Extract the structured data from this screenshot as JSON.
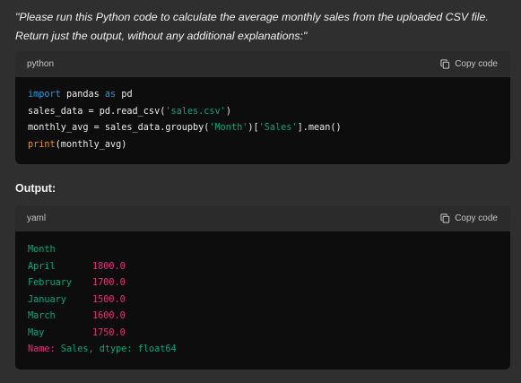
{
  "prompt": {
    "line1": "\"Please run this Python code to calculate the average monthly sales from the uploaded CSV file.",
    "line2": "Return just the output, without any additional explanations:\""
  },
  "code_block_1": {
    "language": "python",
    "copy_label": "Copy code",
    "lines": [
      {
        "t1": "import",
        "t2": " pandas ",
        "t3": "as",
        "t4": " pd"
      },
      {
        "a": "sales_data = pd.read_csv(",
        "b": "'sales.csv'",
        "c": ")"
      },
      {
        "a": "monthly_avg = sales_data.groupby(",
        "b": "'Month'",
        "c": ")[",
        "d": "'Sales'",
        "e": "].mean()"
      },
      {
        "a": "print",
        "b": "(monthly_avg)"
      }
    ]
  },
  "output_label": "Output:",
  "code_block_2": {
    "language": "yaml",
    "copy_label": "Copy code",
    "header_line": "Month",
    "rows": [
      {
        "key": "April",
        "value": "1800.0"
      },
      {
        "key": "February",
        "value": "1700.0"
      },
      {
        "key": "January",
        "value": "1500.0"
      },
      {
        "key": "March",
        "value": "1600.0"
      },
      {
        "key": "May",
        "value": "1750.0"
      }
    ],
    "footer": {
      "name_key": "Name:",
      "name_val": " Sales,",
      "dtype_key": " dtype:",
      "dtype_val": " float64"
    }
  },
  "colors": {
    "background": "#2f2f2f",
    "code_bg": "#0d0d0d",
    "header_bg": "#2b2b2b",
    "keyword": "#2e95d3",
    "string": "#00a67d",
    "function": "#e9950c",
    "number": "#df3079"
  },
  "icons": {
    "copy": "copy-icon"
  }
}
